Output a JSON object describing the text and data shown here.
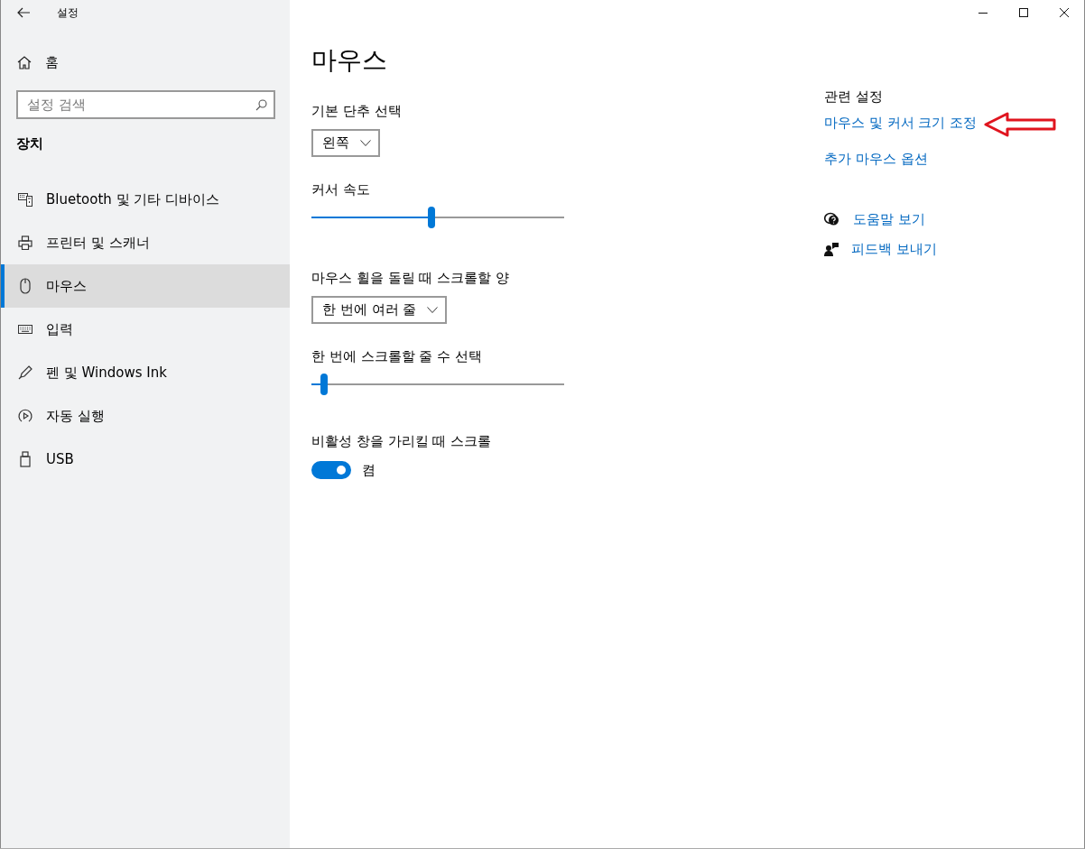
{
  "window": {
    "title": "설정"
  },
  "sidebar": {
    "home": "홈",
    "search": {
      "placeholder": "설정 검색"
    },
    "section": "장치",
    "items": [
      {
        "label": "Bluetooth 및 기타 디바이스",
        "kind": "devices",
        "selected": false
      },
      {
        "label": "프린터 및 스캐너",
        "kind": "printer",
        "selected": false
      },
      {
        "label": "마우스",
        "kind": "mouse",
        "selected": true
      },
      {
        "label": "입력",
        "kind": "keyboard",
        "selected": false
      },
      {
        "label": "펜 및 Windows Ink",
        "kind": "pen",
        "selected": false
      },
      {
        "label": "자동 실행",
        "kind": "autoplay",
        "selected": false
      },
      {
        "label": "USB",
        "kind": "usb",
        "selected": false
      }
    ]
  },
  "page": {
    "title": "마우스",
    "settings": [
      {
        "kind": "dropdown",
        "label": "기본 단추 선택",
        "value": "왼쪽"
      },
      {
        "kind": "slider",
        "label": "커서 속도",
        "level": 0.475
      },
      {
        "kind": "dropdown",
        "label": "마우스 휠을 돌릴 때 스크롤할 양",
        "value": "한 번에 여러 줄"
      },
      {
        "kind": "slider",
        "label": "한 번에 스크롤할 줄 수 선택",
        "level": 0.05
      },
      {
        "kind": "toggle",
        "label": "비활성 창을 가리킬 때 스크롤",
        "on": true,
        "state_text": "켬"
      }
    ]
  },
  "related": {
    "heading": "관련 설정",
    "links": [
      "마우스 및 커서 크기 조정",
      "추가 마우스 옵션"
    ],
    "help": [
      {
        "kind": "help",
        "label": "도움말 보기"
      },
      {
        "kind": "feedback",
        "label": "피드백 보내기"
      }
    ]
  }
}
